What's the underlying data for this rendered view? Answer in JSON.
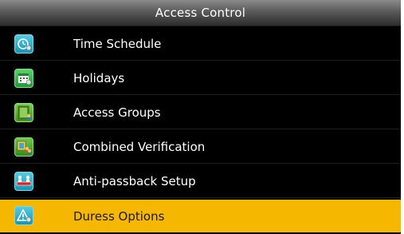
{
  "title": "Access Control",
  "menu": {
    "items": [
      {
        "label": "Time Schedule",
        "icon": "clock-icon"
      },
      {
        "label": "Holidays",
        "icon": "calendar-icon"
      },
      {
        "label": "Access Groups",
        "icon": "group-icon"
      },
      {
        "label": "Combined Verification",
        "icon": "verification-icon"
      },
      {
        "label": "Anti-passback Setup",
        "icon": "anti-passback-icon"
      },
      {
        "label": "Duress Options",
        "icon": "warning-icon"
      }
    ],
    "selected": "Duress Options"
  },
  "colors": {
    "selected_background": "#f6b700",
    "icon_cyan": "#2cb3d0"
  }
}
